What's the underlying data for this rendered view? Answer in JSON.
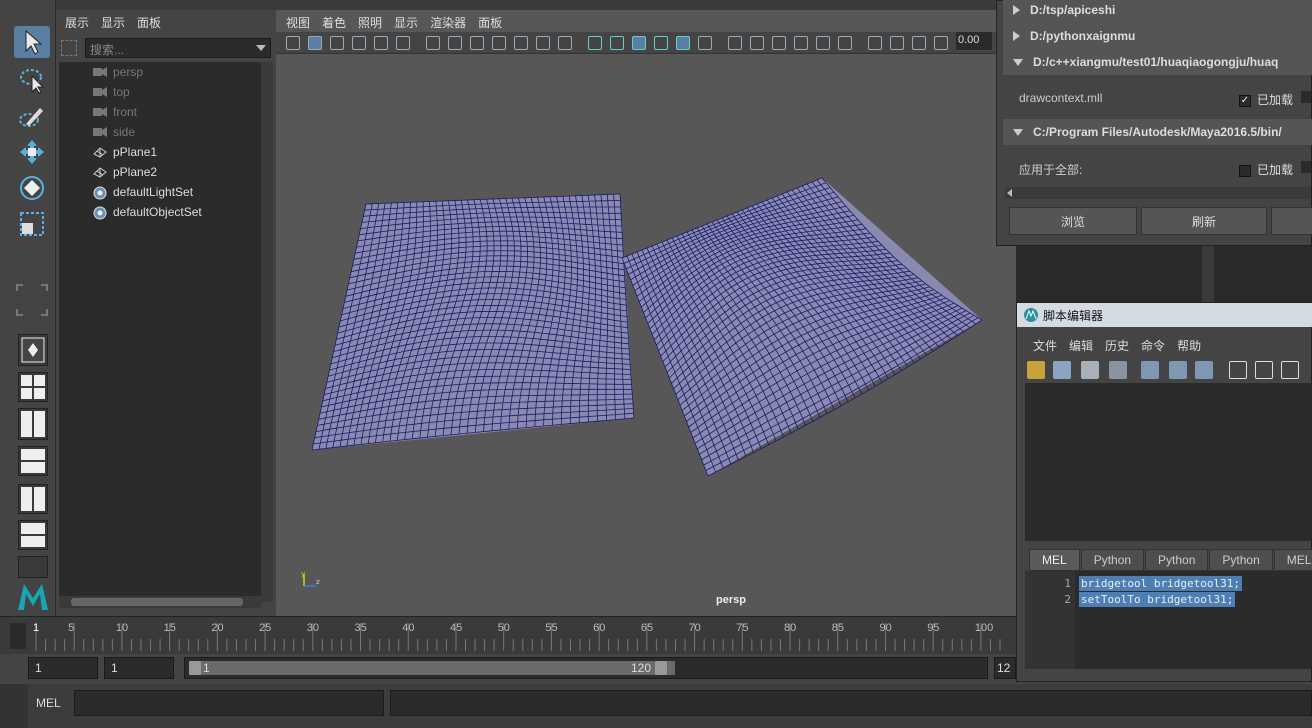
{
  "outliner": {
    "menu": [
      "展示",
      "显示",
      "面板"
    ],
    "search_placeholder": "搜索...",
    "items": [
      {
        "label": "persp",
        "icon": "camera-icon",
        "dim": true
      },
      {
        "label": "top",
        "icon": "camera-icon",
        "dim": true
      },
      {
        "label": "front",
        "icon": "camera-icon",
        "dim": true
      },
      {
        "label": "side",
        "icon": "camera-icon",
        "dim": true
      },
      {
        "label": "pPlane1",
        "icon": "mesh-icon",
        "dim": false
      },
      {
        "label": "pPlane2",
        "icon": "mesh-icon",
        "dim": false
      },
      {
        "label": "defaultLightSet",
        "icon": "set-icon",
        "dim": false
      },
      {
        "label": "defaultObjectSet",
        "icon": "set-icon",
        "dim": false
      }
    ]
  },
  "viewport": {
    "menu": [
      "视图",
      "着色",
      "照明",
      "显示",
      "渲染器",
      "面板"
    ],
    "camera_label": "persp",
    "field_value": "0.00",
    "mesh_color": "#1a1a6e"
  },
  "timeline": {
    "ticks": [
      "1",
      "5",
      "10",
      "15",
      "20",
      "25",
      "30",
      "35",
      "40",
      "45",
      "50",
      "55",
      "60",
      "65",
      "70",
      "75",
      "80",
      "85",
      "90",
      "95",
      "100"
    ],
    "range_start": "1",
    "range_start2": "1",
    "slider_start": "1",
    "slider_end": "120",
    "range_end": "12"
  },
  "command_line": {
    "label": "MEL"
  },
  "plugin_manager": {
    "paths": [
      {
        "label": "D:/tsp/apiceshi",
        "expanded": false
      },
      {
        "label": "D:/pythonxaignmu",
        "expanded": false
      },
      {
        "label": "D:/c++xiangmu/test01/huaqiaogongju/huaq",
        "expanded": true
      },
      {
        "label": "C:/Program Files/Autodesk/Maya2016.5/bin/",
        "expanded": true
      }
    ],
    "plugin_name": "drawcontext.mll",
    "loaded_label": "已加载",
    "apply_all_label": "应用于全部:",
    "loaded_label2": "已加载",
    "browse_label": "浏览",
    "refresh_label": "刷新"
  },
  "script_editor": {
    "title": "脚本编辑器",
    "menu": [
      "文件",
      "编辑",
      "历史",
      "命令",
      "帮助"
    ],
    "tabs": [
      "MEL",
      "Python",
      "Python",
      "Python",
      "MEL"
    ],
    "lines": [
      {
        "num": "1",
        "code": "bridgetool bridgetool31;"
      },
      {
        "num": "2",
        "code": "setToolTo bridgetool31;"
      }
    ]
  }
}
